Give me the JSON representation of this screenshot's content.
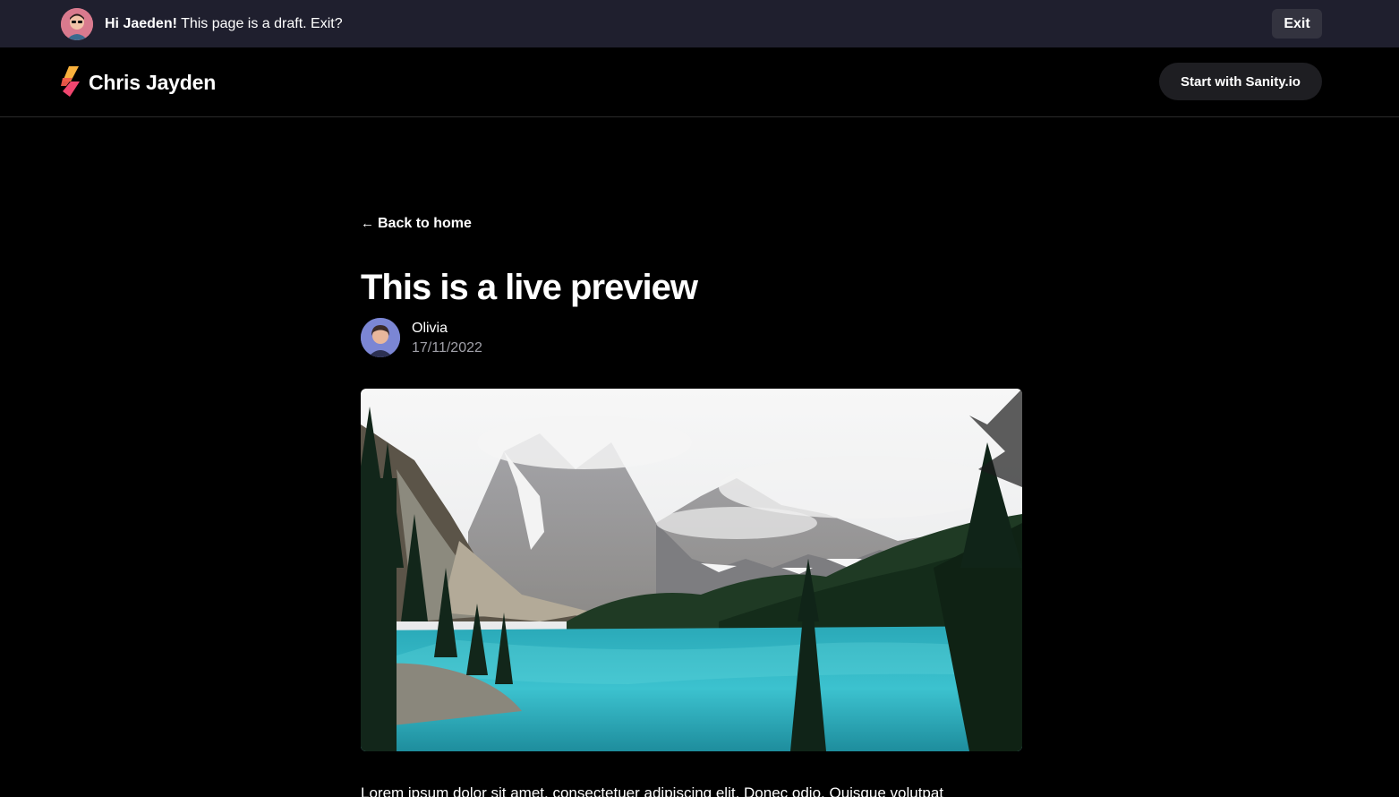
{
  "draft_banner": {
    "greeting": "Hi Jaeden!",
    "message": " This page is a draft. Exit?",
    "exit_label": "Exit",
    "avatar_icon": "user-avatar-icon"
  },
  "header": {
    "site_name": "Chris Jayden",
    "logo_icon": "sanity-logo-icon",
    "cta_label": "Start with Sanity.io"
  },
  "article": {
    "back_label": "Back to home",
    "back_icon": "arrow-left-icon",
    "title": "This is a live preview",
    "author": "Olivia",
    "date": "17/11/2022",
    "hero_alt": "mountain-lake-photo",
    "body_start": "Lorem ipsum dolor sit amet, consectetuer adipiscing elit. Donec odio. Quisque volutpat"
  },
  "colors": {
    "banner_bg": "#1f1f2e",
    "page_bg": "#000000",
    "button_bg": "#1e1e22",
    "muted_text": "#a0a0a8"
  }
}
